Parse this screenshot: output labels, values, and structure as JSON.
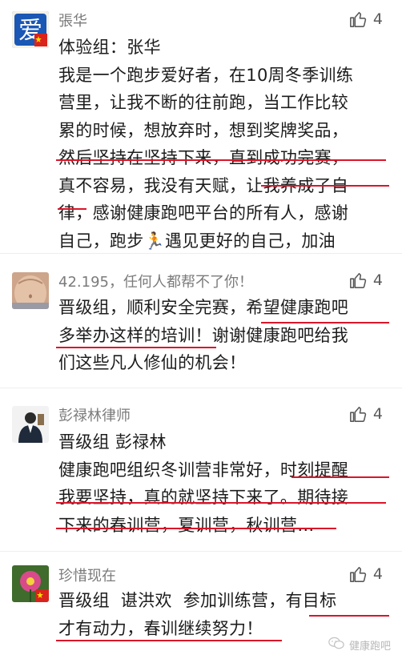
{
  "comments": [
    {
      "author": "張华",
      "likes": "4",
      "lines": [
        "体验组：张华",
        "我是一个跑步爱好者，在10周冬季训练",
        "营里，让我不断的往前跑，当工作比较",
        "累的时候，想放弃时，想到奖牌奖品，",
        "然后坚持在坚持下来，直到成功完赛，",
        "真不容易，我没有天赋，让我养成了自",
        "律，感谢健康跑吧平台的所有人，感谢",
        "自己，跑步🏃遇见更好的自己，加油"
      ]
    },
    {
      "author": "42.195，任何人都帮不了你！",
      "likes": "4",
      "lines": [
        "晋级组，顺利安全完赛，希望健康跑吧",
        "多举办这样的培训！谢谢健康跑吧给我",
        "们这些凡人修仙的机会！"
      ]
    },
    {
      "author": "彭禄林律师",
      "likes": "4",
      "lines": [
        "晋级组 彭禄林",
        "健康跑吧组织冬训营非常好，时刻提醒",
        "我要坚持，真的就坚持下来了。期待接",
        "下来的春训营，夏训营，秋训营…"
      ]
    },
    {
      "author": "珍惜现在",
      "likes": "4",
      "lines": [
        "晋级组  谌洪欢  参加训练营，有目标",
        "才有动力，春训继续努力！"
      ]
    }
  ],
  "avatar_text": {
    "first": "爱"
  },
  "watermark": {
    "label": "健康跑吧"
  },
  "colors": {
    "underline": "#d9162a",
    "author": "#7b7b7b",
    "text": "#1c1c1c"
  }
}
